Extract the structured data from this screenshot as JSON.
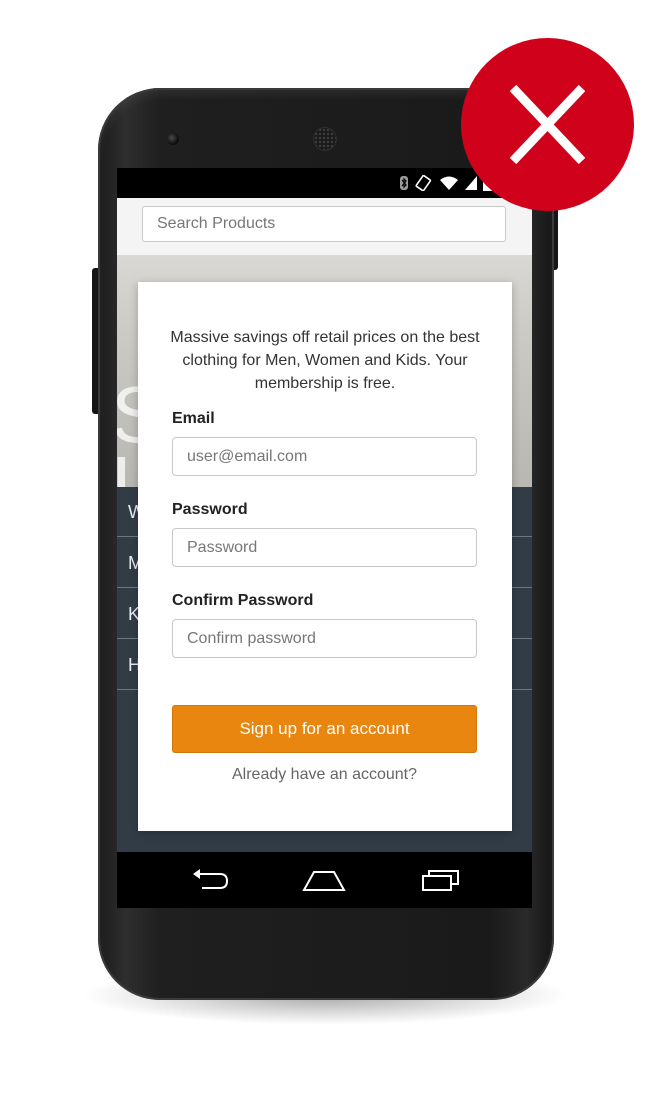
{
  "search": {
    "placeholder": "Search Products"
  },
  "hero": {
    "text_fragment": "S\nL"
  },
  "nav": {
    "items": [
      {
        "label": "W"
      },
      {
        "label": "M"
      },
      {
        "label": "K"
      },
      {
        "label": "H"
      }
    ]
  },
  "modal": {
    "intro": "Massive savings off retail prices on the best clothing for Men, Women and Kids. Your membership is free.",
    "email": {
      "label": "Email",
      "placeholder": "user@email.com"
    },
    "password": {
      "label": "Password",
      "placeholder": "Password"
    },
    "confirm_password": {
      "label": "Confirm Password",
      "placeholder": "Confirm password"
    },
    "signup_button": "Sign up for an account",
    "login_link": "Already have an account?"
  },
  "status_bar": {
    "icons": [
      "bluetooth-icon",
      "rotate-icon",
      "wifi-icon",
      "signal-icon",
      "battery-icon"
    ]
  },
  "system_nav": {
    "icons": [
      "back-icon",
      "home-icon",
      "recents-icon"
    ]
  },
  "badge": {
    "icon": "close-icon",
    "meaning": "reject"
  },
  "colors": {
    "accent_button": "#e8860f",
    "nav_background": "#323c47",
    "badge_red": "#d0021b"
  }
}
